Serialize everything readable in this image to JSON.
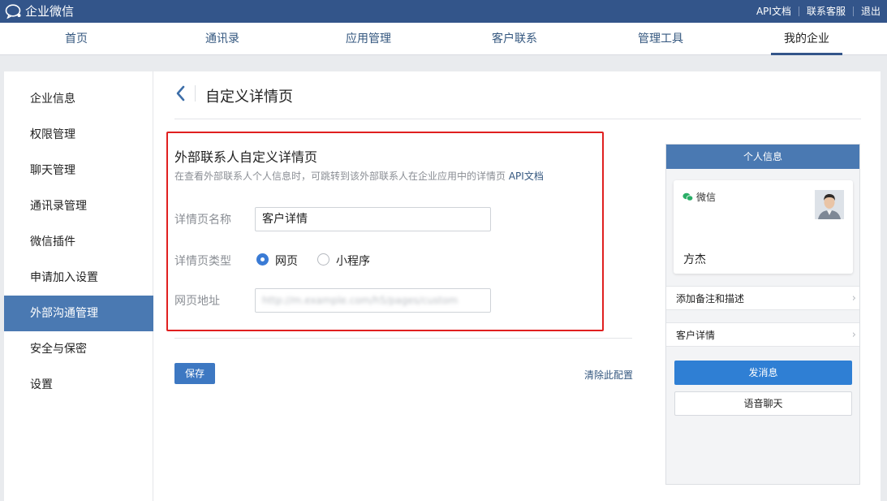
{
  "topbar": {
    "app_title": "企业微信",
    "links": [
      "API文档",
      "联系客服",
      "退出"
    ]
  },
  "nav": {
    "items": [
      "首页",
      "通讯录",
      "应用管理",
      "客户联系",
      "管理工具",
      "我的企业"
    ],
    "active": "我的企业"
  },
  "sidebar": {
    "items": [
      "企业信息",
      "权限管理",
      "聊天管理",
      "通讯录管理",
      "微信插件",
      "申请加入设置",
      "外部沟通管理",
      "安全与保密",
      "设置"
    ],
    "active": "外部沟通管理"
  },
  "page": {
    "title": "自定义详情页"
  },
  "form": {
    "section_title": "外部联系人自定义详情页",
    "description": "在查看外部联系人个人信息时，可跳转到该外部联系人在企业应用中的详情页",
    "api_link": "API文档",
    "name_label": "详情页名称",
    "name_value": "客户详情",
    "type_label": "详情页类型",
    "type_options": [
      "网页",
      "小程序"
    ],
    "type_selected": "网页",
    "url_label": "网页地址",
    "url_value": "http://m.example.com/h5/pages/custom",
    "save_label": "保存",
    "clear_label": "清除此配置"
  },
  "preview": {
    "header": "个人信息",
    "source_label": "微信",
    "contact_name": "方杰",
    "rows": [
      "添加备注和描述",
      "客户详情"
    ],
    "send_message": "发消息",
    "voice_chat": "语音聊天"
  },
  "colors": {
    "topbar": "#33558a",
    "active_sidebar": "#4a79b2",
    "highlight_border": "#e02020",
    "primary_button": "#2f7fd4",
    "wechat_green": "#2aae67"
  }
}
